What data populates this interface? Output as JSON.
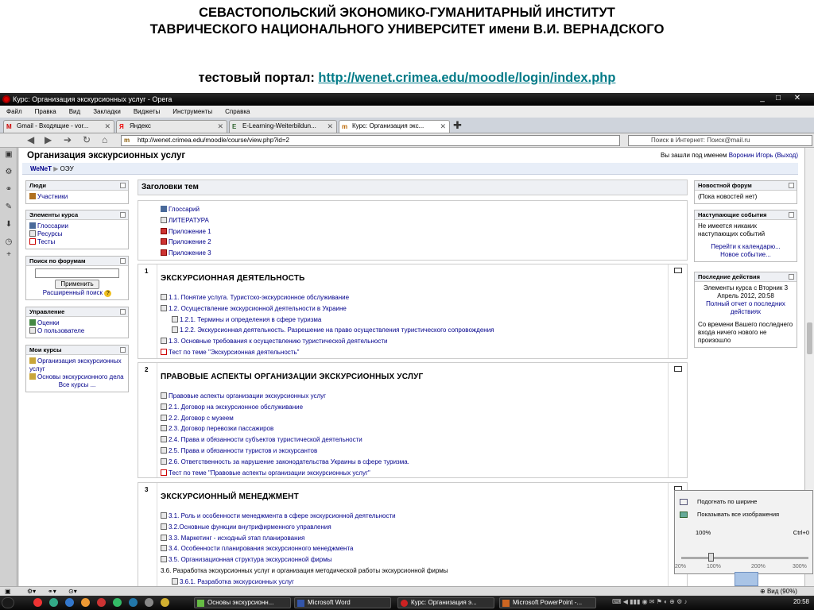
{
  "slide": {
    "line1": "СЕВАСТОПОЛЬСКИЙ ЭКОНОМИКО-ГУМАНИТАРНЫЙ ИНСТИТУТ",
    "line2": "ТАВРИЧЕСКОГО НАЦИОНАЛЬНОГО УНИВЕРСИТЕТ имени В.И. ВЕРНАДСКОГО",
    "portal_label": "тестовый портал:",
    "portal_url": "http://wenet.crimea.edu/moodle/login/index.php"
  },
  "window": {
    "title": "Курс: Организация экскурсионных услуг - Opera",
    "min": "_",
    "max": "□",
    "close": "✕"
  },
  "menu": [
    "Файл",
    "Правка",
    "Вид",
    "Закладки",
    "Виджеты",
    "Инструменты",
    "Справка"
  ],
  "tabs": [
    {
      "label": "Gmail - Входящие - vor...",
      "fav": "M"
    },
    {
      "label": "Яндекс",
      "fav": "Я"
    },
    {
      "label": "E-Learning-Weiterbildun...",
      "fav": "E"
    },
    {
      "label": "Курс: Организация экс...",
      "fav": "m"
    }
  ],
  "address": "http://wenet.crimea.edu/moodle/course/view.php?id=2",
  "search_placeholder": "Поиск в Интернет: Поиск@mail.ru",
  "page": {
    "course_title": "Организация экскурсионных услуг",
    "login_prefix": "Вы зашли под именем",
    "login_user": "Воронин Игорь",
    "logout": "(Выход)",
    "crumb_home": "WeNeT",
    "crumb_sep": "▶",
    "crumb_current": "ОЭУ",
    "topics_heading": "Заголовки тем"
  },
  "left": {
    "people": {
      "title": "Люди",
      "participants": "Участники"
    },
    "elements": {
      "title": "Элементы курса",
      "items": [
        "Глоссарии",
        "Ресурсы",
        "Тесты"
      ]
    },
    "forum_search": {
      "title": "Поиск по форумам",
      "button": "Применить",
      "advanced": "Расширенный поиск"
    },
    "admin": {
      "title": "Управление",
      "items": [
        "Оценки",
        "О пользователе"
      ]
    },
    "mycourses": {
      "title": "Мои курсы",
      "items": [
        "Организация экскурсионных услуг",
        "Основы экскурсионного дела"
      ],
      "all": "Все курсы ..."
    }
  },
  "right": {
    "news": {
      "title": "Новостной форум",
      "text": "(Пока новостей нет)"
    },
    "events": {
      "title": "Наступающие события",
      "text": "Не имеется никаких наступающих событий",
      "link1": "Перейти к календарю...",
      "link2": "Новое событие..."
    },
    "recent": {
      "title": "Последние действия",
      "text1": "Элементы курса с Вторник 3 Апрель 2012, 20:58",
      "link": "Полный отчет о последних действиях",
      "text2": "Со времени Вашего последнего входа ничего нового не произошло"
    }
  },
  "section0": [
    "Глоссарий",
    "ЛИТЕРАТУРА",
    "Приложение 1",
    "Приложение 2",
    "Приложение 3"
  ],
  "section1": {
    "num": "1",
    "title": "ЭКСКУРСИОННАЯ ДЕЯТЕЛЬНОСТЬ",
    "items": [
      "1.1. Понятие услуга. Туристско-экскурсионное обслуживание",
      "1.2. Осуществление экскурсионной деятельности в Украине",
      "1.2.1. Термины и определения в сфере туризма",
      "1.2.2. Экскурсионная деятельность. Разрешение на право осуществления туристического сопровождения",
      "1.3. Основные требования к осуществлению туристической деятельности",
      "Тест по теме \"Экскурсионная деятельность\""
    ]
  },
  "section2": {
    "num": "2",
    "title": "ПРАВОВЫЕ АСПЕКТЫ ОРГАНИЗАЦИИ ЭКСКУРСИОННЫХ УСЛУГ",
    "items": [
      "Правовые аспекты организации экскурсионных услуг",
      "2.1. Договор на экскурсионное обслуживание",
      "2.2. Договор с музеем",
      "2.3. Договор перевозки пассажиров",
      "2.4. Права и обязанности субъектов туристической деятельности",
      "2.5. Права и обязанности туристов и экскурсантов",
      "2.6. Ответственность за нарушение законодательства Украины в сфере туризма.",
      "Тест по теме \"Правовые аспекты организации экскурсионных услуг\""
    ]
  },
  "section3": {
    "num": "3",
    "title": "ЭКСКУРСИОННЫЙ МЕНЕДЖМЕНТ",
    "items": [
      "3.1. Роль и особенности менеджмента в сфере экскурсионной деятельности",
      "3.2.Основные функции внутрифирменного управления",
      "3.3. Маркетинг - исходный этап планирования",
      "3.4. Особенности планирования экскурсионного менеджмента",
      "3.5. Организационная структура экскурсионной фирмы",
      "3.6. Разработка экскурсионных услуг и организация методической работы экскурсионной фирмы",
      "3.6.1. Разработка экскурсионных услуг"
    ]
  },
  "zoom": {
    "fit_width": "Подогнать по ширине",
    "show_images": "Показывать все изображения",
    "level": "100%",
    "shortcut": "Ctrl+0",
    "level_value": 90,
    "ticks": [
      "20%",
      "100%",
      "200%",
      "300%"
    ]
  },
  "status": {
    "zoom": "Вид (90%)"
  },
  "taskbar": {
    "items": [
      "Основы экскурсионн...",
      "Microsoft Word",
      "Курс: Организация э...",
      "Microsoft PowerPoint -..."
    ],
    "clock": "20:58"
  }
}
